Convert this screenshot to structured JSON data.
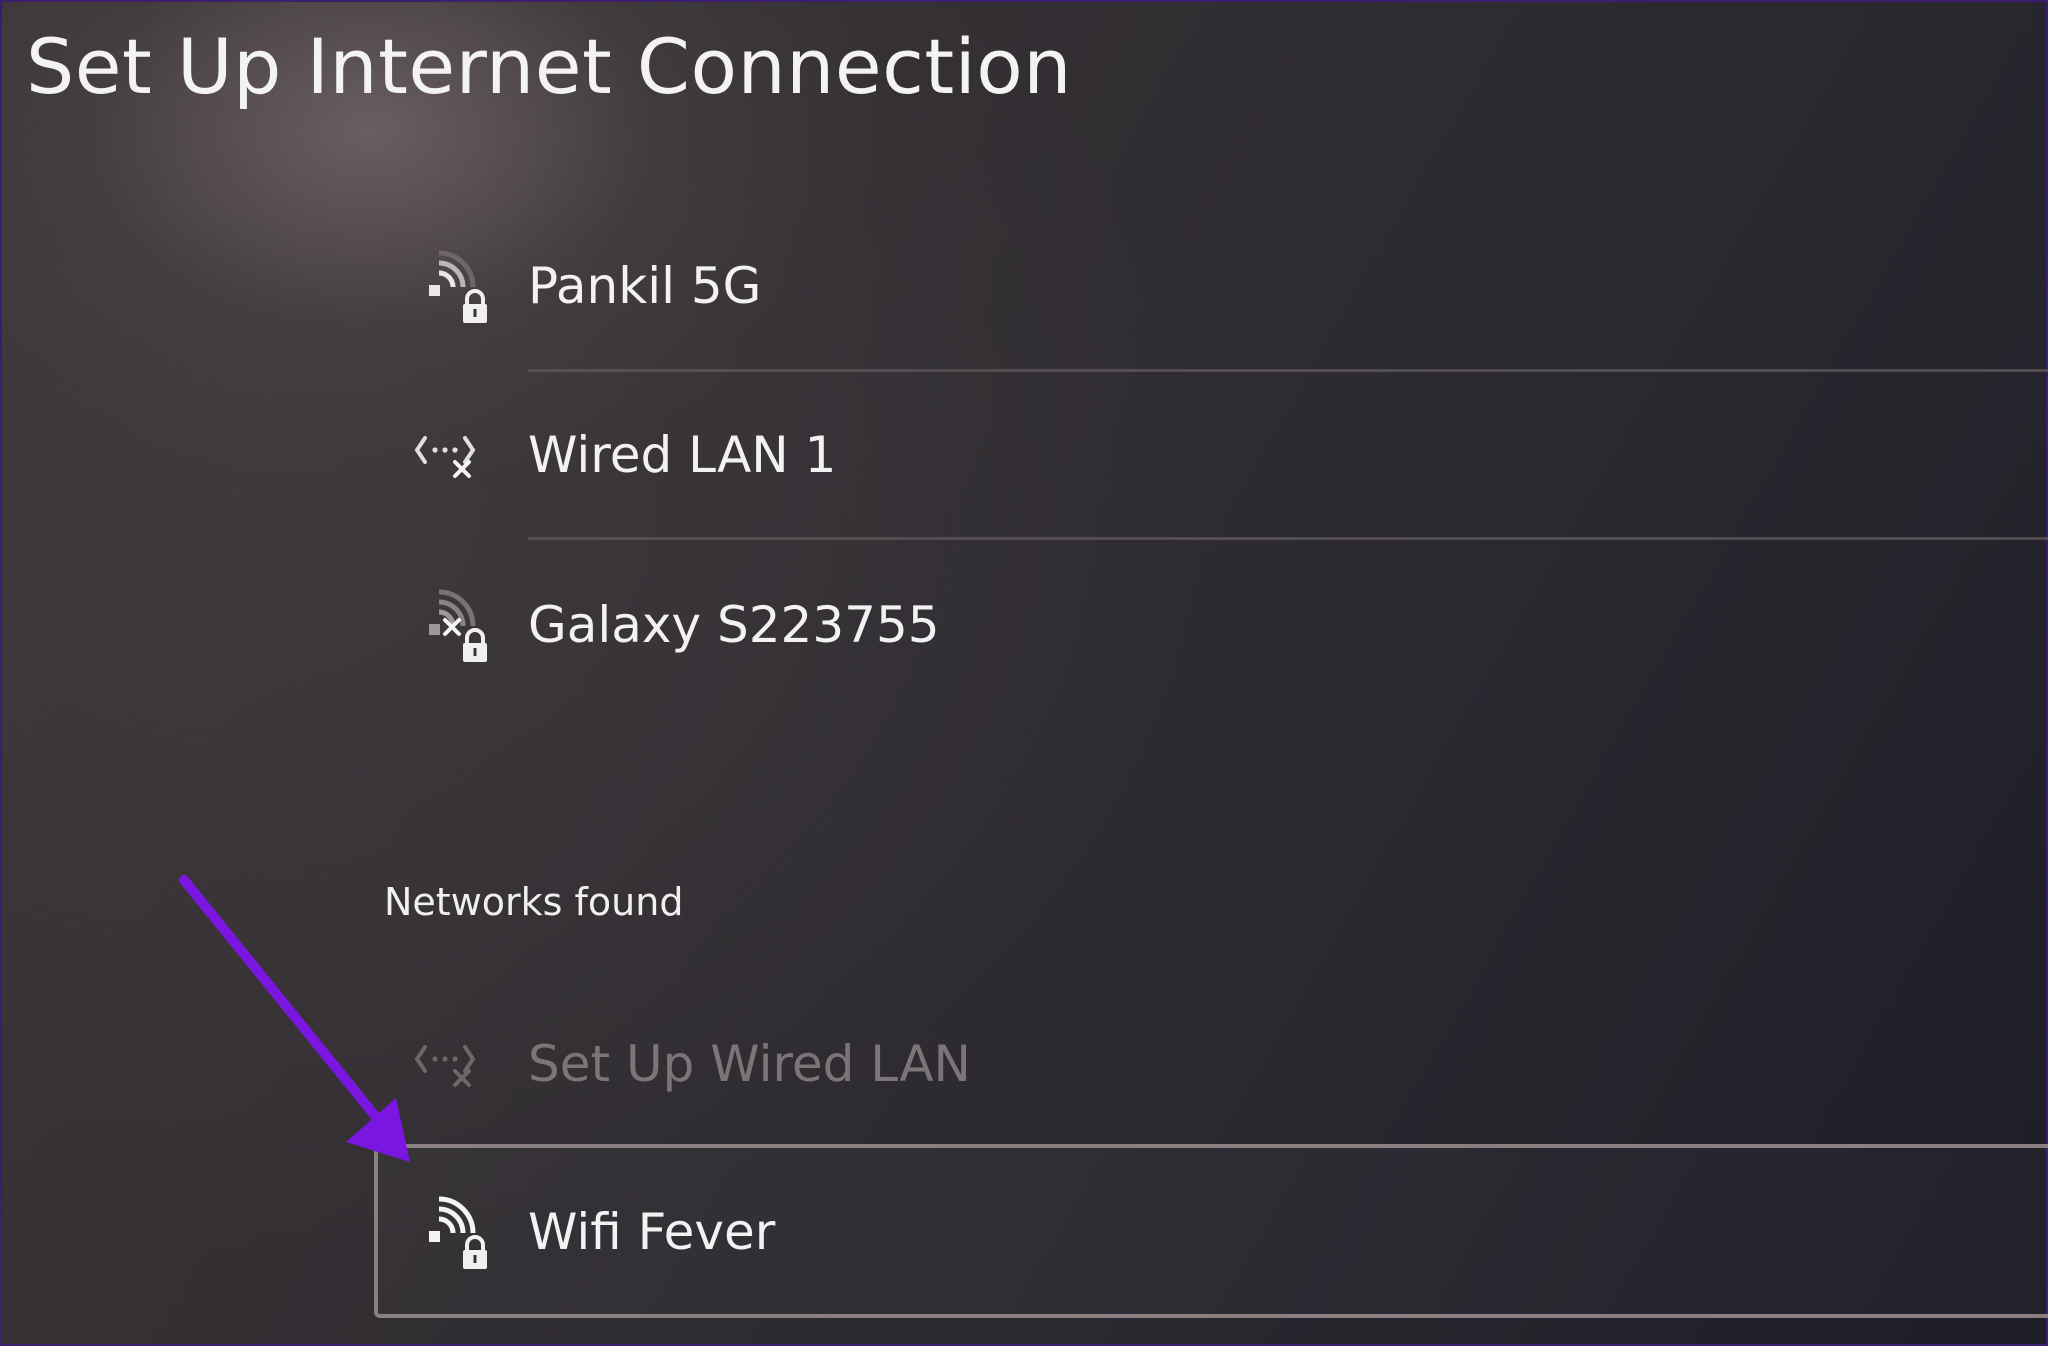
{
  "page": {
    "title": "Set Up Internet Connection"
  },
  "saved_networks": [
    {
      "label": "Pankil 5G",
      "icon": "wifi-locked-icon"
    },
    {
      "label": "Wired LAN 1",
      "icon": "wired-lan-disconnected-icon"
    },
    {
      "label": "Galaxy S223755",
      "icon": "wifi-disconnected-locked-icon"
    }
  ],
  "networks_found": {
    "heading": "Networks found",
    "items": [
      {
        "label": "Set Up Wired LAN",
        "icon": "wired-lan-disconnected-icon",
        "state": "disabled"
      },
      {
        "label": "Wifi Fever",
        "icon": "wifi-locked-icon",
        "state": "selected"
      }
    ]
  },
  "colors": {
    "annotation_arrow": "#7b16e0",
    "selection_border": "#8a8082",
    "dim_text": "#7d7478"
  }
}
